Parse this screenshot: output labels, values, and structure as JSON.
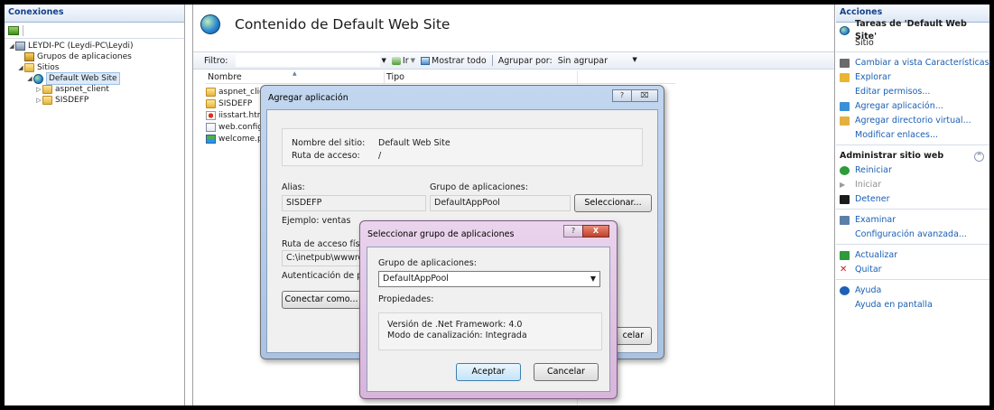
{
  "left": {
    "title": "Conexiones",
    "tree": [
      {
        "label": "LEYDI-PC (Leydi-PC\\Leydi)",
        "icon": "server-icon",
        "twisty": "◢",
        "indent": 0
      },
      {
        "label": "Grupos de aplicaciones",
        "icon": "app-pool-icon",
        "twisty": "",
        "indent": 1
      },
      {
        "label": "Sitios",
        "icon": "folder-icon",
        "twisty": "◢",
        "indent": 1
      },
      {
        "label": "Default Web Site",
        "icon": "globe-icon",
        "twisty": "◢",
        "indent": 2
      },
      {
        "label": "aspnet_client",
        "icon": "folder-icon",
        "twisty": "▷",
        "indent": 3
      },
      {
        "label": "SISDEFP",
        "icon": "folder-icon",
        "twisty": "▷",
        "indent": 3
      }
    ]
  },
  "center": {
    "title": "Contenido de Default Web Site",
    "filter_label": "Filtro:",
    "go_label": "Ir",
    "show_all_label": "Mostrar todo",
    "group_by_label": "Agrupar por:",
    "group_by_value": "Sin agrupar",
    "columns": [
      "Nombre",
      "Tipo"
    ],
    "items": [
      {
        "name": "aspnet_clie",
        "icon": "folder-icon"
      },
      {
        "name": "SISDEFP",
        "icon": "folder-icon"
      },
      {
        "name": "iisstart.htm",
        "icon": "html-file-icon"
      },
      {
        "name": "web.config",
        "icon": "config-file-icon"
      },
      {
        "name": "welcome.p",
        "icon": "image-file-icon"
      }
    ]
  },
  "add_app_dialog": {
    "title": "Agregar aplicación",
    "help_glyph": "?",
    "close_glyph": "⌧",
    "site_name_label": "Nombre del sitio:",
    "site_name_value": "Default Web Site",
    "path_label": "Ruta de acceso:",
    "path_value": "/",
    "alias_label": "Alias:",
    "alias_value": "SISDEFP",
    "pool_label": "Grupo de aplicaciones:",
    "pool_value": "DefaultAppPool",
    "select_button": "Seleccionar...",
    "example_label": "Ejemplo: ventas",
    "physical_path_label": "Ruta de acceso físic",
    "physical_path_value": "C:\\inetpub\\wwwro",
    "auth_label": "Autenticación de p",
    "connect_as_button": "Conectar como...",
    "cancel_partial": "celar"
  },
  "select_pool_dialog": {
    "title": "Seleccionar grupo de aplicaciones",
    "help_glyph": "?",
    "close_glyph": "X",
    "pool_label": "Grupo de aplicaciones:",
    "pool_value": "DefaultAppPool",
    "properties_label": "Propiedades:",
    "framework_line": "Versión de .Net Framework: 4.0",
    "pipeline_line": "Modo de canalización: Integrada",
    "ok_button": "Aceptar",
    "cancel_button": "Cancelar"
  },
  "right": {
    "title": "Acciones",
    "site_tasks_title": "Tareas de 'Default Web Site'",
    "site_tasks_sub": "Sitio",
    "actions1": [
      {
        "label": "Cambiar a vista Características",
        "icon": "features-view-icon",
        "color": "#6b6b6b"
      },
      {
        "label": "Explorar",
        "icon": "explore-folder-icon",
        "color": "#eab532"
      },
      {
        "label": "Editar permisos...",
        "icon": "",
        "color": ""
      },
      {
        "label": "Agregar aplicación...",
        "icon": "add-application-icon",
        "color": "#3a8fd8"
      },
      {
        "label": "Agregar directorio virtual...",
        "icon": "add-virtual-directory-icon",
        "color": "#e3b23c"
      },
      {
        "label": "Modificar enlaces...",
        "icon": "",
        "color": ""
      }
    ],
    "manage_title": "Administrar sitio web",
    "collapse_glyph": "^",
    "actions2": [
      {
        "label": "Reiniciar",
        "icon": "restart-icon",
        "color": "#2e9a3a",
        "disabled": false
      },
      {
        "label": "Iniciar",
        "icon": "start-icon",
        "color": "#9a9a9a",
        "disabled": true
      },
      {
        "label": "Detener",
        "icon": "stop-icon",
        "color": "#1b1b1b",
        "disabled": false
      }
    ],
    "actions3": [
      {
        "label": "Examinar",
        "icon": "browse-icon",
        "color": "#5c7fa8"
      },
      {
        "label": "Configuración avanzada...",
        "icon": "",
        "color": ""
      }
    ],
    "actions4": [
      {
        "label": "Actualizar",
        "icon": "refresh-icon",
        "color": "#2e9a3a"
      },
      {
        "label": "Quitar",
        "icon": "remove-icon",
        "color": "#d01a1a"
      }
    ],
    "actions5": [
      {
        "label": "Ayuda",
        "icon": "help-icon",
        "color": "#1f5fb8"
      },
      {
        "label": "Ayuda en pantalla",
        "icon": "",
        "color": ""
      }
    ]
  }
}
